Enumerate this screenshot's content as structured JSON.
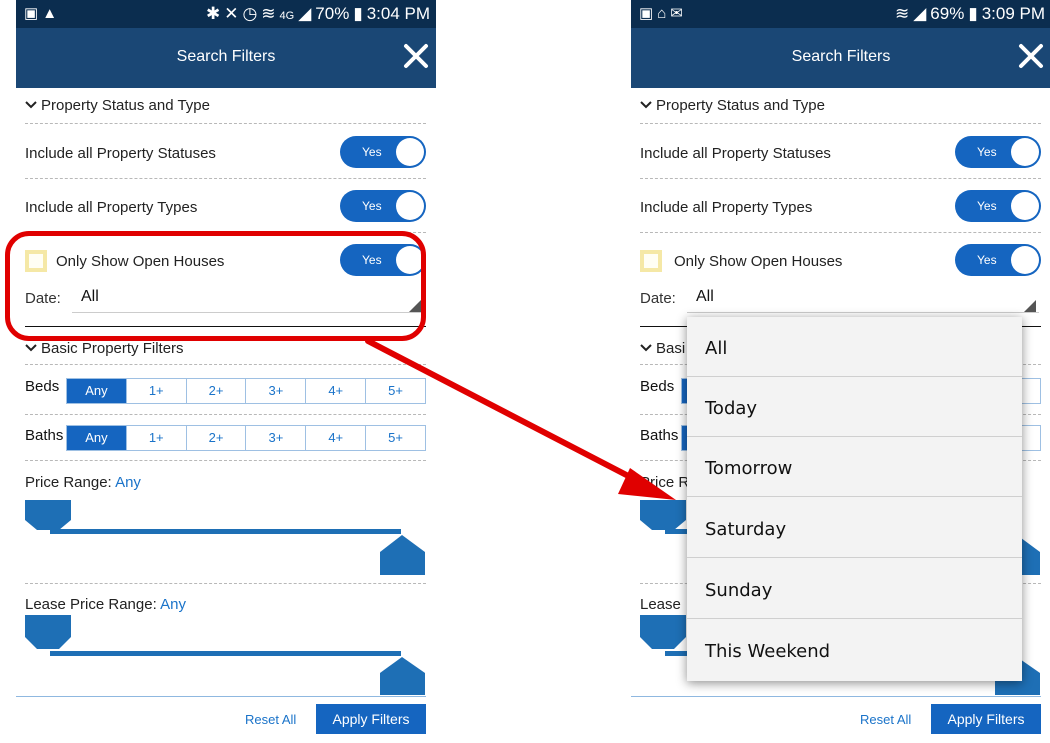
{
  "left_screen": {
    "status_bar": {
      "left_icons": [
        "image-icon",
        "warning-icon"
      ],
      "right_icons": [
        "bluetooth-icon",
        "mute-icon",
        "alarm-icon",
        "wifi-icon",
        "lte-icon",
        "signal-icon"
      ],
      "lte": "4G",
      "battery_percent": "70%",
      "time": "3:04 PM"
    },
    "header": {
      "title": "Search Filters"
    },
    "filters": {
      "section_status": "Property Status and Type",
      "include_statuses": {
        "label": "Include all Property Statuses",
        "toggle": "Yes"
      },
      "include_types": {
        "label": "Include all Property Types",
        "toggle": "Yes"
      },
      "open_houses": {
        "label": "Only Show Open Houses",
        "toggle": "Yes"
      },
      "date": {
        "label": "Date:",
        "value": "All"
      },
      "section_basic": "Basic Property Filters",
      "beds": {
        "label": "Beds",
        "options": [
          "Any",
          "1+",
          "2+",
          "3+",
          "4+",
          "5+"
        ],
        "selected": "Any"
      },
      "baths": {
        "label": "Baths",
        "options": [
          "Any",
          "1+",
          "2+",
          "3+",
          "4+",
          "5+"
        ],
        "selected": "Any"
      },
      "price_range": {
        "label": "Price Range:",
        "value": "Any"
      },
      "lease_price_range": {
        "label": "Lease Price Range:",
        "value": "Any"
      }
    },
    "footer": {
      "reset": "Reset All",
      "apply": "Apply Filters"
    }
  },
  "right_screen": {
    "status_bar": {
      "left_icons": [
        "image-icon",
        "home-icon",
        "mail-icon"
      ],
      "right_icons": [
        "wifi-icon",
        "signal-icon"
      ],
      "battery_percent": "69%",
      "time": "3:09 PM"
    },
    "header": {
      "title": "Search Filters"
    },
    "filters": {
      "section_status": "Property Status and Type",
      "include_statuses": {
        "label": "Include all Property Statuses",
        "toggle": "Yes"
      },
      "include_types": {
        "label": "Include all Property Types",
        "toggle": "Yes"
      },
      "open_houses": {
        "label": "Only Show Open Houses",
        "toggle": "Yes"
      },
      "date": {
        "label": "Date:",
        "value": "All"
      },
      "section_basic_partial": "Basi",
      "beds_label": "Beds",
      "baths_label": "Baths",
      "price_partial": "Price R",
      "lease_partial": "Lease"
    },
    "dropdown_options": [
      "All",
      "Today",
      "Tomorrow",
      "Saturday",
      "Sunday",
      "This Weekend"
    ],
    "footer": {
      "reset": "Reset All",
      "apply": "Apply Filters"
    }
  },
  "colors": {
    "status_bar": "#0b2d4f",
    "header": "#1a4775",
    "accent": "#1565c0",
    "link": "#1a73c9",
    "annotation": "#e00000"
  }
}
